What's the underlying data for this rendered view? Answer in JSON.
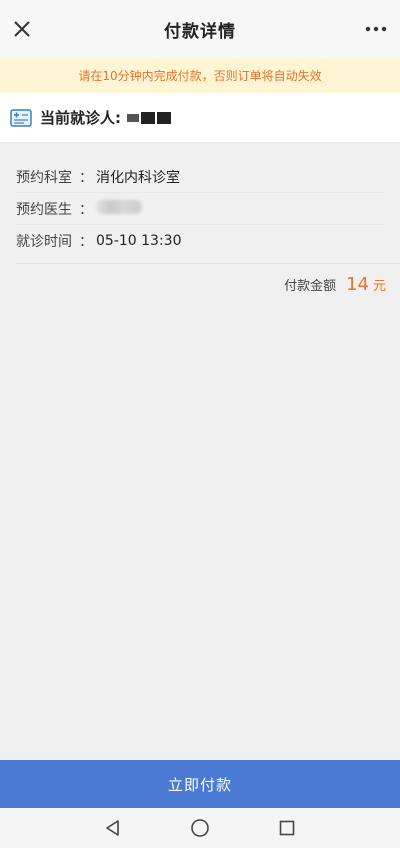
{
  "header": {
    "title": "付款详情",
    "close_icon": "close-icon",
    "more_icon": "more-icon"
  },
  "notice": {
    "text": "请在10分钟内完成付款，否则订单将自动失效"
  },
  "patient": {
    "label": "当前就诊人:",
    "icon": "id-card-icon"
  },
  "details": {
    "rows": [
      {
        "label": "预约科室",
        "colon": "：",
        "value": "消化内科诊室"
      },
      {
        "label": "预约医生",
        "colon": "：",
        "value": ""
      },
      {
        "label": "就诊时间",
        "colon": "：",
        "value": "05-10 13:30"
      }
    ]
  },
  "payment": {
    "label": "付款金额",
    "value": "14",
    "unit": "元",
    "accent_color": "#e8742d"
  },
  "pay_button": {
    "label": "立即付款",
    "color": "#4a7ad3"
  },
  "system_nav": {
    "back_icon": "back-triangle-icon",
    "home_icon": "home-circle-icon",
    "recents_icon": "recents-square-icon"
  }
}
